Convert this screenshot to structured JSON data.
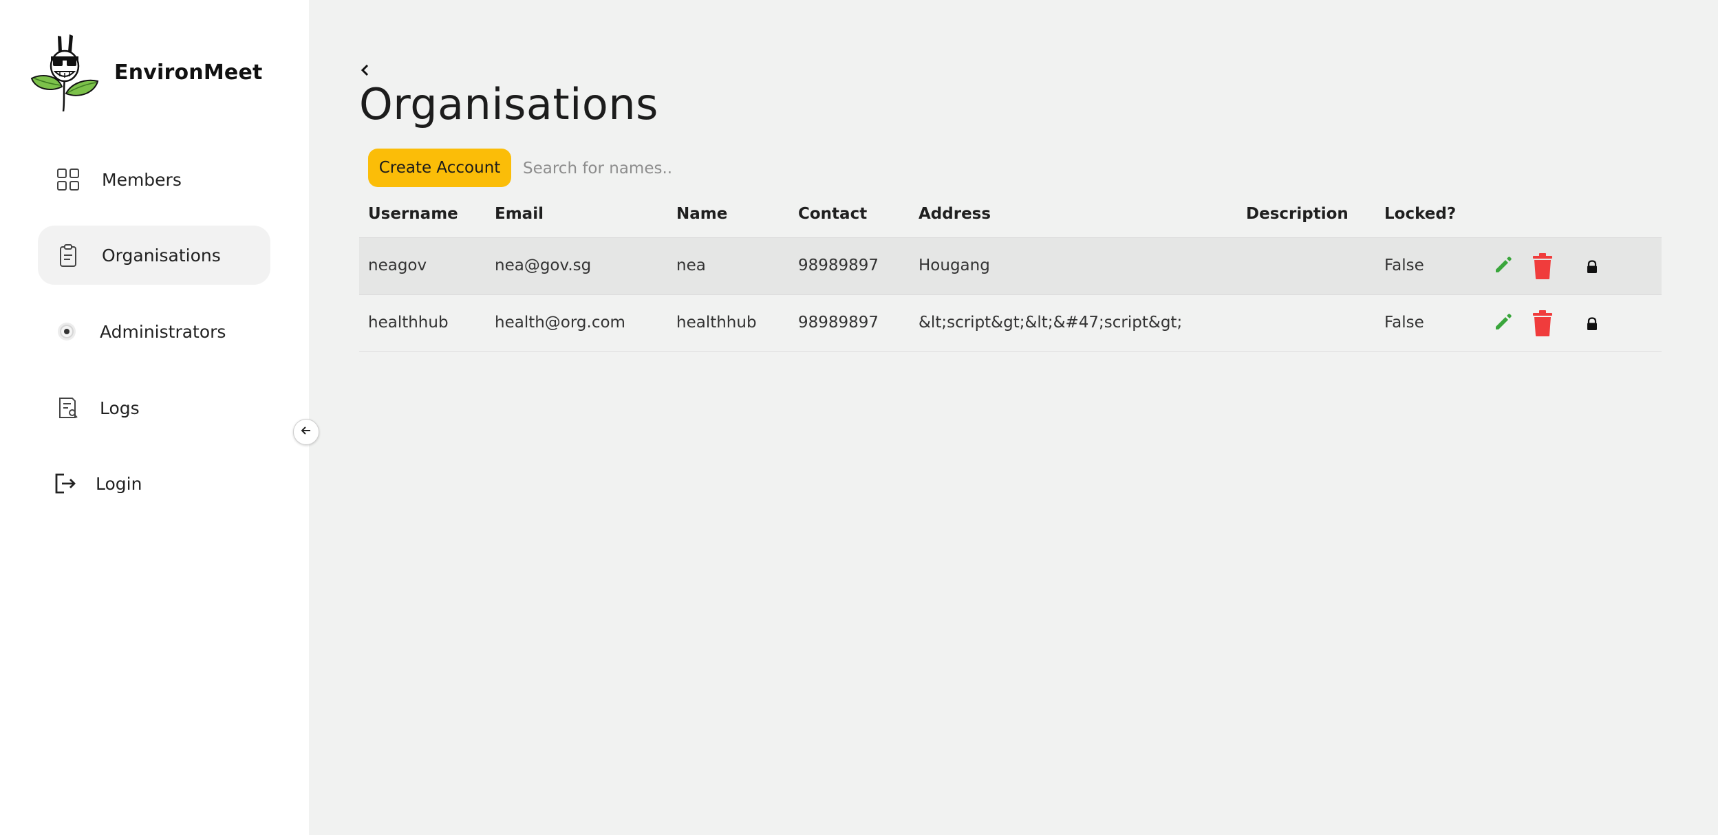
{
  "brand": {
    "name": "EnvironMeet",
    "logo_icon": "plant-mascot-logo-icon"
  },
  "sidebar": {
    "items": [
      {
        "label": "Members",
        "icon": "grid-icon",
        "active": false
      },
      {
        "label": "Organisations",
        "icon": "clipboard-icon",
        "active": true
      },
      {
        "label": "Administrators",
        "icon": "gear-icon",
        "active": false
      },
      {
        "label": "Logs",
        "icon": "document-search-icon",
        "active": false
      },
      {
        "label": "Login",
        "icon": "login-icon",
        "active": false
      }
    ],
    "collapse_icon": "arrow-left-icon"
  },
  "page": {
    "title": "Organisations",
    "back_icon": "chevron-left-icon"
  },
  "toolbar": {
    "create_label": "Create Account",
    "search_placeholder": "Search for names..",
    "search_value": ""
  },
  "table": {
    "columns": [
      "Username",
      "Email",
      "Name",
      "Contact",
      "Address",
      "Description",
      "Locked?"
    ],
    "rows": [
      {
        "username": "neagov",
        "email": "nea@gov.sg",
        "name": "nea",
        "contact": "98989897",
        "address": "Hougang",
        "description": "",
        "locked": "False"
      },
      {
        "username": "healthhub",
        "email": "health@org.com",
        "name": "healthhub",
        "contact": "98989897",
        "address": "&lt;script&gt;&lt;&#47;script&gt;",
        "description": "",
        "locked": "False"
      }
    ],
    "action_icons": [
      "pencil-icon",
      "trash-icon",
      "lock-icon"
    ]
  },
  "colors": {
    "accent": "#fbbd08",
    "edit": "#3aa63c",
    "delete": "#f03c3c",
    "sidebar_bg": "#ffffff",
    "main_bg": "#f1f2f1"
  }
}
